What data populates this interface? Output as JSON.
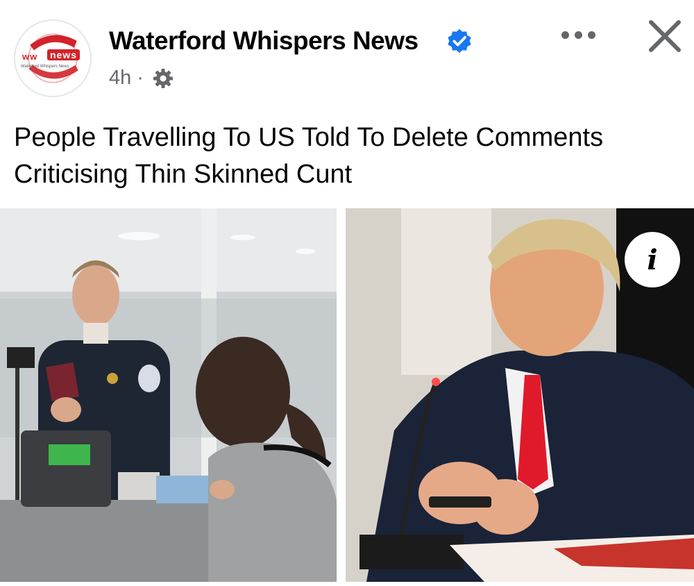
{
  "post": {
    "page_name": "Waterford Whispers News",
    "timestamp": "4h",
    "separator": "·",
    "audience_icon": "gear-icon",
    "verified_icon": "verified-badge-icon",
    "headline": "People Travelling To US Told To Delete Comments Criticising Thin Skinned Cunt"
  },
  "avatar": {
    "logo_ww": "ww",
    "logo_news": "news",
    "logo_sub": "Waterford Whispers News"
  },
  "actions": {
    "more_icon": "more-horizontal-icon",
    "close_icon": "close-icon",
    "info_label": "i",
    "info_icon": "info-icon"
  },
  "colors": {
    "brand_red": "#d3232a",
    "verified_blue": "#1877f2",
    "secondary_text": "#65676b"
  }
}
